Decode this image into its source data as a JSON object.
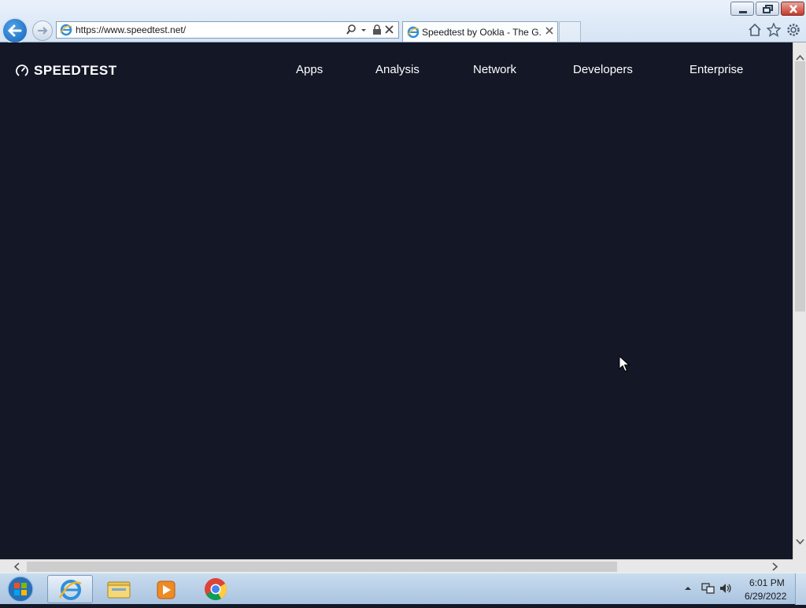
{
  "browser": {
    "address_url": "https://www.speedtest.net/",
    "tab_title": "Speedtest by Ookla - The G...",
    "icons": [
      "back-arrow-icon",
      "forward-arrow-icon",
      "ie-logo-icon",
      "search-icon",
      "dropdown-icon",
      "lock-icon",
      "stop-icon",
      "close-icon",
      "home-icon",
      "favorites-star-icon",
      "gear-icon"
    ]
  },
  "window": {
    "controls": [
      "minimize",
      "restore",
      "close"
    ]
  },
  "site": {
    "logo_text": "SPEEDTEST",
    "nav": [
      "Apps",
      "Analysis",
      "Network",
      "Developers",
      "Enterprise"
    ],
    "background_color": "#141726"
  },
  "taskbar": {
    "pinned": [
      "start-orb",
      "internet-explorer",
      "windows-explorer",
      "media-player",
      "chrome"
    ],
    "clock_time": "6:01 PM",
    "clock_date": "6/29/2022"
  }
}
